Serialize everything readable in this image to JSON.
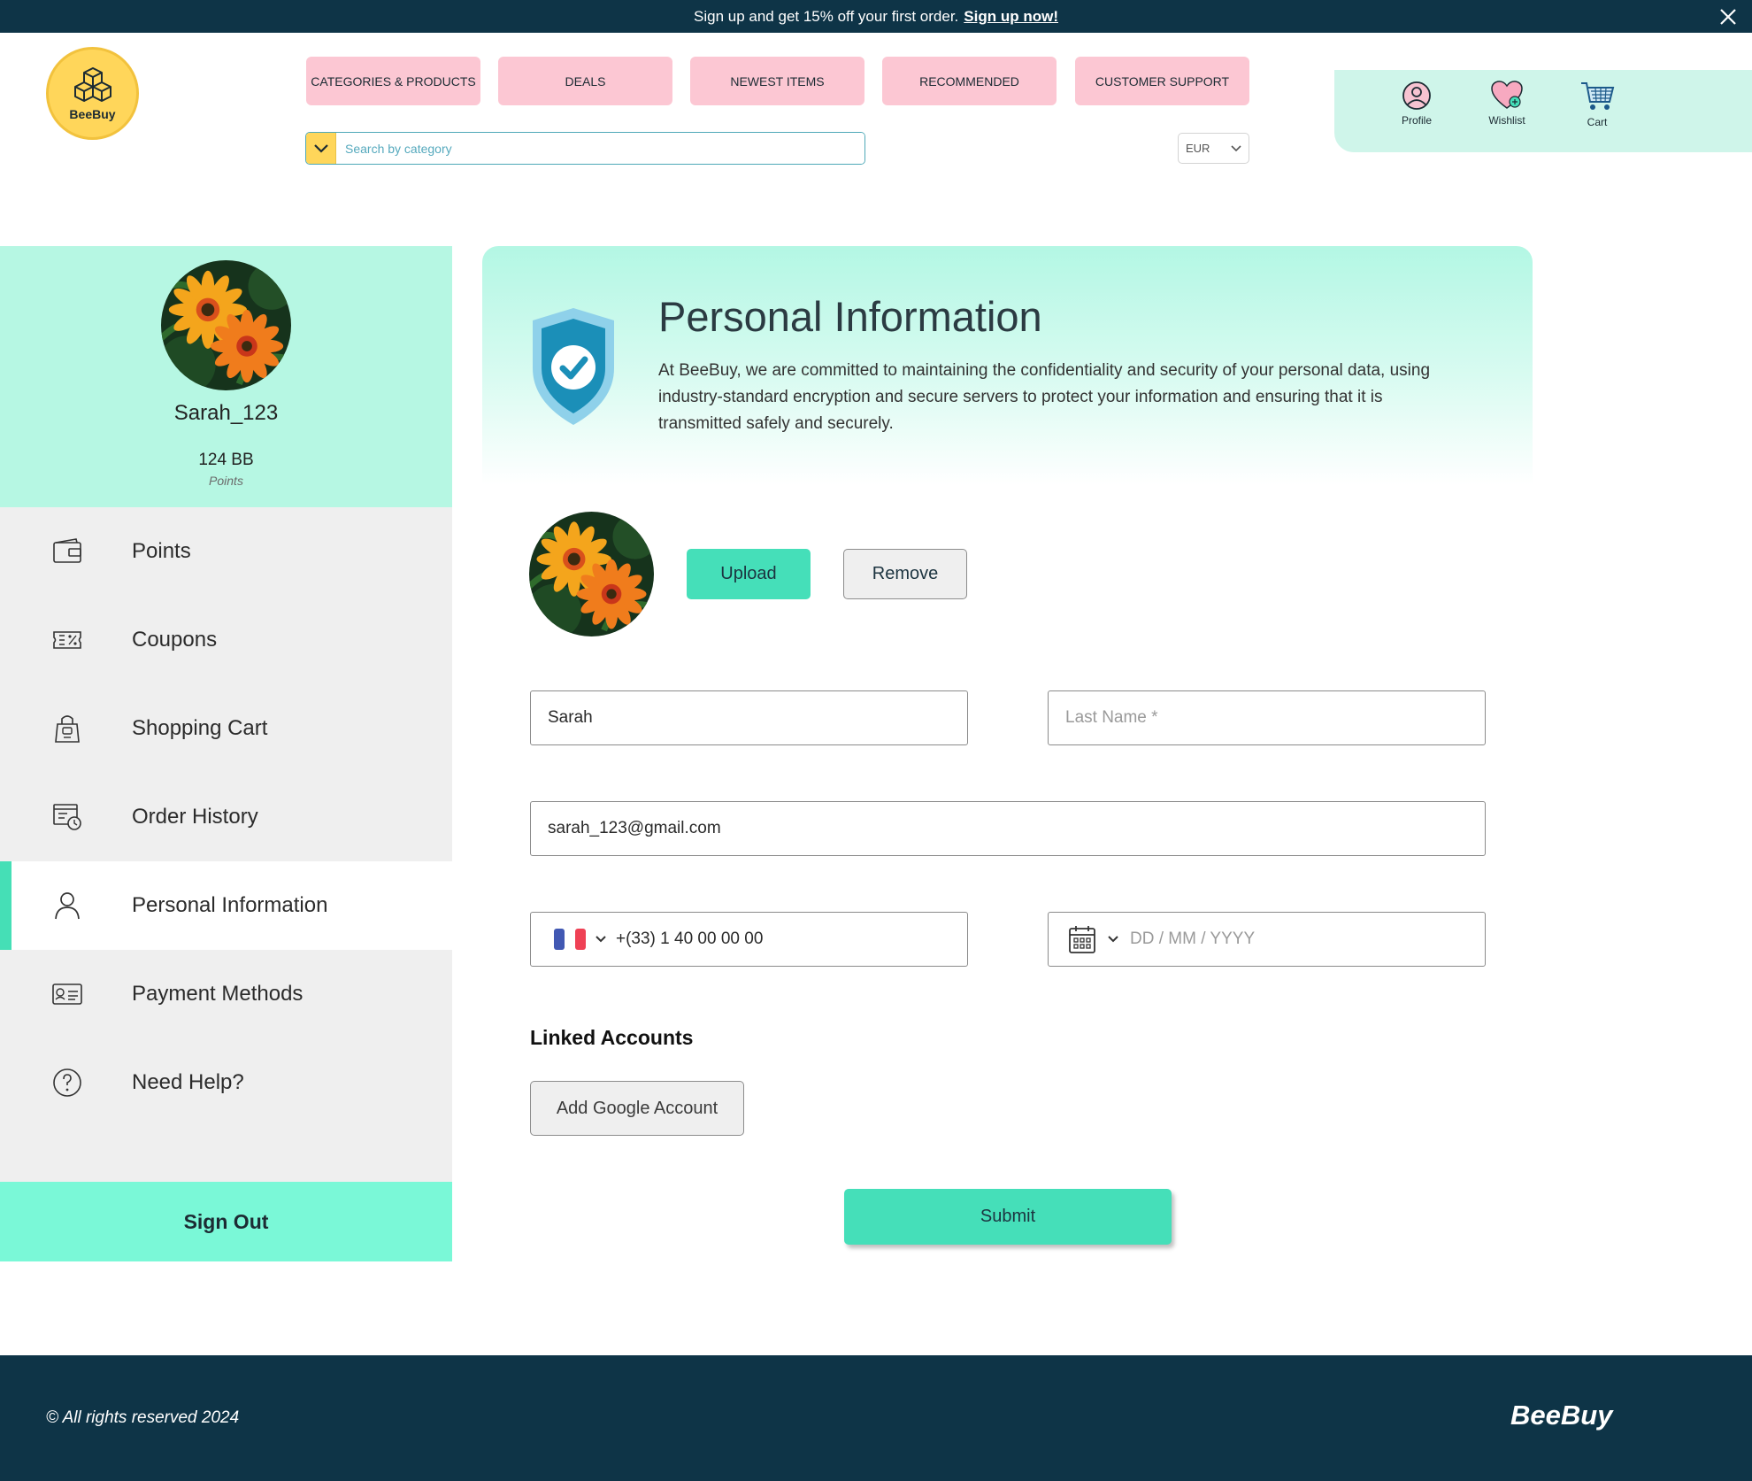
{
  "promo": {
    "text": "Sign up and get 15% off your first order.",
    "link": "Sign up now!"
  },
  "brand": {
    "logo_text": "BeeBuy"
  },
  "nav": [
    {
      "label": "CATEGORIES & PRODUCTS"
    },
    {
      "label": "DEALS"
    },
    {
      "label": "NEWEST ITEMS"
    },
    {
      "label": "RECOMMENDED"
    },
    {
      "label": "CUSTOMER SUPPORT"
    }
  ],
  "search": {
    "placeholder": "Search by category",
    "value": ""
  },
  "currency": {
    "selected": "EUR"
  },
  "user_actions": {
    "profile": "Profile",
    "wishlist": "Wishlist",
    "cart": "Cart"
  },
  "sidebar": {
    "username": "Sarah_123",
    "points_value": "124 BB",
    "points_label": "Points",
    "items": [
      {
        "label": "Points",
        "icon": "wallet-icon",
        "active": false
      },
      {
        "label": "Coupons",
        "icon": "coupon-icon",
        "active": false
      },
      {
        "label": "Shopping Cart",
        "icon": "shopping-bag-icon",
        "active": false
      },
      {
        "label": "Order History",
        "icon": "order-history-icon",
        "active": false
      },
      {
        "label": "Personal Information",
        "icon": "user-icon",
        "active": true
      },
      {
        "label": "Payment Methods",
        "icon": "payment-card-icon",
        "active": false
      },
      {
        "label": "Need Help?",
        "icon": "help-icon",
        "active": false
      }
    ],
    "sign_out": "Sign Out"
  },
  "main": {
    "title": "Personal Information",
    "description": "At BeeBuy, we are committed to maintaining the confidentiality and security of your personal data, using industry-standard encryption and secure servers to protect your information and ensuring that it is transmitted safely and securely.",
    "upload_label": "Upload",
    "remove_label": "Remove",
    "first_name": {
      "value": "Sarah",
      "placeholder": ""
    },
    "last_name": {
      "value": "",
      "placeholder": "Last Name *"
    },
    "email": {
      "value": "sarah_123@gmail.com",
      "placeholder": ""
    },
    "phone": {
      "value": "+(33) 1 40 00 00 00",
      "placeholder": ""
    },
    "birthdate": {
      "value": "",
      "placeholder": "DD / MM / YYYY"
    },
    "linked_title": "Linked Accounts",
    "add_google": "Add Google Account",
    "submit": "Submit"
  },
  "footer": {
    "copyright": "© All rights reserved 2024",
    "brand": "BeeBuy"
  },
  "colors": {
    "navy": "#0e3447",
    "mint": "#45dfb9",
    "mint_light": "#b6f7e3",
    "pink": "#fcc7d3",
    "yellow": "#ffd65a"
  }
}
